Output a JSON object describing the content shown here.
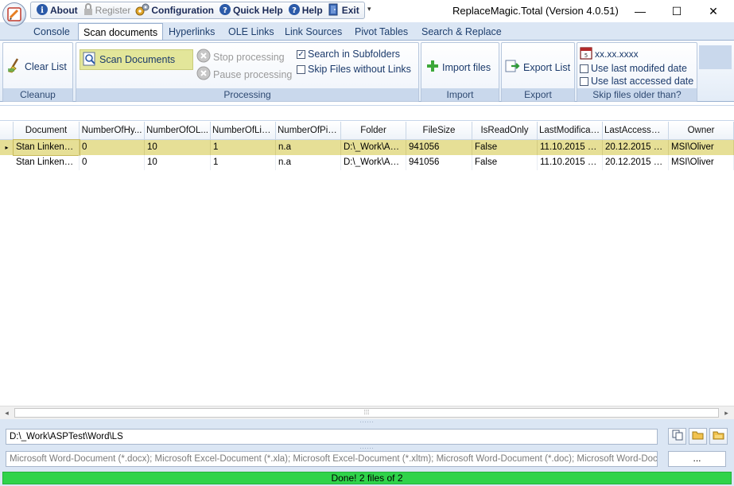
{
  "title_bar": {
    "window_title": "ReplaceMagic.Total (Version 4.0.51)",
    "quick_access": [
      {
        "label": "About",
        "icon": "info-icon",
        "enabled": true
      },
      {
        "label": "Register",
        "icon": "lock-icon",
        "enabled": false
      },
      {
        "label": "Configuration",
        "icon": "gears-icon",
        "enabled": true
      },
      {
        "label": "Quick Help",
        "icon": "help-icon",
        "enabled": true
      },
      {
        "label": "Help",
        "icon": "help-icon",
        "enabled": true
      },
      {
        "label": "Exit",
        "icon": "exit-door-icon",
        "enabled": true
      }
    ],
    "controls": {
      "minimize": "—",
      "maximize": "☐",
      "close": "✕"
    }
  },
  "tabs": [
    {
      "label": "Console",
      "active": false
    },
    {
      "label": "Scan documents",
      "active": true
    },
    {
      "label": "Hyperlinks",
      "active": false
    },
    {
      "label": "OLE Links",
      "active": false
    },
    {
      "label": "Link Sources",
      "active": false
    },
    {
      "label": "Pivot Tables",
      "active": false
    },
    {
      "label": "Search & Replace",
      "active": false
    }
  ],
  "ribbon": {
    "cleanup": {
      "label": "Cleanup",
      "clear_list": "Clear List"
    },
    "processing": {
      "label": "Processing",
      "scan_documents": "Scan Documents",
      "stop_processing": "Stop processing",
      "pause_processing": "Pause processing",
      "search_in_subfolders": {
        "label": "Search in Subfolders",
        "checked": true
      },
      "skip_files_without_links": {
        "label": "Skip Files without Links",
        "checked": false
      }
    },
    "import": {
      "label": "Import",
      "import_files": "Import files"
    },
    "export": {
      "label": "Export",
      "export_list": "Export List"
    },
    "skip_older": {
      "label": "Skip files older than?",
      "date_value": "xx.xx.xxxx",
      "use_last_modified": {
        "label": "Use last modifed date",
        "checked": false
      },
      "use_last_accessed": {
        "label": "Use last accessed date",
        "checked": false
      }
    }
  },
  "grid": {
    "columns": [
      "Document",
      "NumberOfHy...",
      "NumberOfOL...",
      "NumberOfLin...",
      "NumberOfPiv...",
      "Folder",
      "FileSize",
      "IsReadOnly",
      "LastModificati...",
      "LastAccessDate",
      "Owner"
    ],
    "rows": [
      {
        "selected": true,
        "indicator": "▸",
        "cells": [
          "Stan Linkenh...",
          "0",
          "10",
          "1",
          "n.a",
          "D:\\_Work\\AS...",
          "941056",
          "False",
          "11.10.2015 1...",
          "20.12.2015 0...",
          "MSI\\Oliver"
        ]
      },
      {
        "selected": false,
        "indicator": "",
        "cells": [
          "Stan Linkenh...",
          "0",
          "10",
          "1",
          "n.a",
          "D:\\_Work\\AS...",
          "941056",
          "False",
          "11.10.2015 1...",
          "20.12.2015 0...",
          "MSI\\Oliver"
        ]
      }
    ]
  },
  "scrollbar": {
    "left": "◂",
    "right": "▸",
    "grip": "⁞⁞⁞"
  },
  "bottom": {
    "path_value": "D:\\_Work\\ASPTest\\Word\\LS",
    "filter_value": "Microsoft Word-Document (*.docx); Microsoft Excel-Document (*.xla); Microsoft Excel-Document (*.xltm); Microsoft Word-Document (*.doc); Microsoft Word-Document",
    "browse_label": "..."
  },
  "status": {
    "message": "Done! 2 files of 2",
    "progress": 1.0
  },
  "colors": {
    "accent": "#dbe6f4",
    "selection": "#e6df96",
    "progress": "#2fd34a"
  }
}
